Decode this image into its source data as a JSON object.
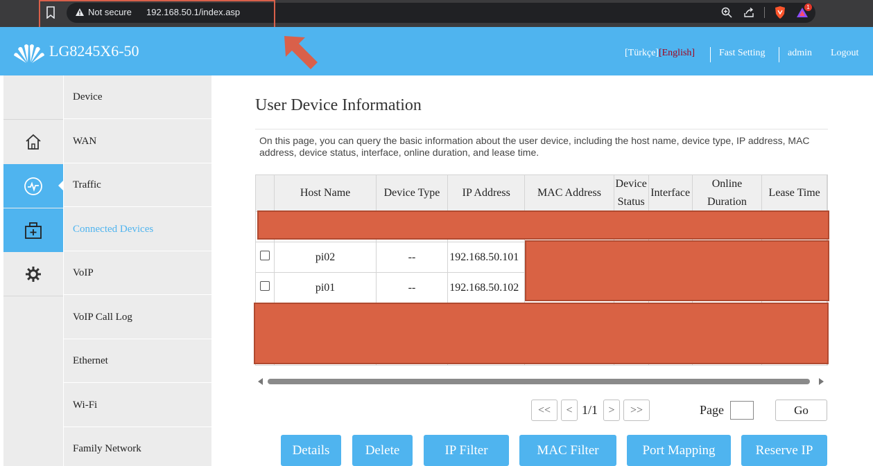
{
  "browser": {
    "security_label": "Not secure",
    "url": "192.168.50.1/index.asp",
    "brave_badge": "1"
  },
  "header": {
    "brand": "LG8245X6-50",
    "lang_inactive": "[Türkçe]",
    "lang_active": "[English]",
    "fast_setting": "Fast Setting",
    "user": "admin",
    "logout": "Logout"
  },
  "sidebar": {
    "icons": [
      "home-icon",
      "traffic-icon",
      "medical-kit-icon",
      "gear-icon"
    ],
    "items": [
      {
        "label": "Device"
      },
      {
        "label": "WAN"
      },
      {
        "label": "Traffic"
      },
      {
        "label": "Connected Devices"
      },
      {
        "label": "VoIP"
      },
      {
        "label": "VoIP Call Log"
      },
      {
        "label": "Ethernet"
      },
      {
        "label": "Wi-Fi"
      },
      {
        "label": "Family Network"
      }
    ]
  },
  "main": {
    "title": "User Device Information",
    "description": "On this page, you can query the basic information about the user device, including the host name, device type, IP address, MAC address, device status, interface, online duration, and lease time.",
    "columns": [
      "Host Name",
      "Device Type",
      "IP Address",
      "MAC Address",
      "Device Status",
      "Interface",
      "Online Duration",
      "Lease Time"
    ],
    "rows": [
      {
        "host": "pi02",
        "type": "--",
        "ip": "192.168.50.101"
      },
      {
        "host": "pi01",
        "type": "--",
        "ip": "192.168.50.102"
      }
    ]
  },
  "pager": {
    "first": "<<",
    "prev": "<",
    "current": "1/1",
    "next": ">",
    "last": ">>",
    "page_label": "Page",
    "go": "Go"
  },
  "actions": {
    "details": "Details",
    "delete": "Delete",
    "ip_filter": "IP Filter",
    "mac_filter": "MAC Filter",
    "port_mapping": "Port Mapping",
    "reserve_ip": "Reserve IP"
  },
  "colors": {
    "accent": "#4fb4ef",
    "redaction": "#d96244",
    "active_lang": "#a3001a"
  }
}
